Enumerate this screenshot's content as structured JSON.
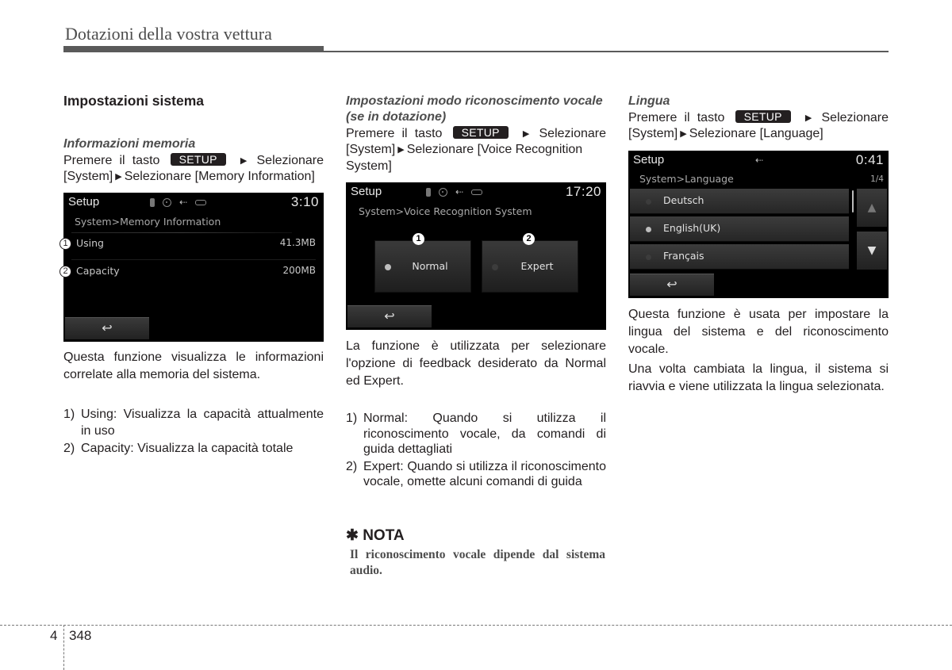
{
  "header": {
    "running_title": "Dotazioni della vostra vettura"
  },
  "setup_key_label": "SETUP",
  "column1": {
    "section_title": "Impostazioni sistema",
    "subtitle": "Informazioni memoria",
    "instruction": {
      "prefix": "Premere il tasto",
      "step1": "Selezionare",
      "line2_a": "[System]",
      "line2_b": "Selezionare [Memory Information]"
    },
    "screen": {
      "title": "Setup",
      "time": "3:10",
      "breadcrumb": "System>Memory Information",
      "rows": [
        {
          "callout": "1",
          "label": "Using",
          "value": "41.3MB"
        },
        {
          "callout": "2",
          "label": "Capacity",
          "value": "200MB"
        }
      ],
      "back_icon": "↩"
    },
    "description": "Questa funzione visualizza le informazioni correlate alla memoria del sistema.",
    "list": [
      {
        "num": "1)",
        "text": "Using: Visualizza la capacità attualmente in uso"
      },
      {
        "num": "2)",
        "text": "Capacity: Visualizza la capacità totale"
      }
    ]
  },
  "column2": {
    "subtitle": "Impostazioni modo riconoscimento vocale (se in dotazione)",
    "instruction": {
      "prefix": "Premere il tasto",
      "step1": "Selezionare",
      "line2_a": "[System]",
      "line2_b": "Selezionare [Voice Recognition System]"
    },
    "screen": {
      "title": "Setup",
      "time": "17:20",
      "breadcrumb": "System>Voice Recognition System",
      "options": [
        {
          "callout": "1",
          "label": "Normal",
          "selected": true
        },
        {
          "callout": "2",
          "label": "Expert",
          "selected": false
        }
      ],
      "back_icon": "↩"
    },
    "description": "La funzione è utilizzata per selezionare l'opzione di feedback desiderato da Normal ed Expert.",
    "list": [
      {
        "num": "1)",
        "text": "Normal: Quando si utilizza il riconoscimento vocale, da comandi di guida dettagliati"
      },
      {
        "num": "2)",
        "text": "Expert: Quando si utilizza il riconoscimento vocale, omette alcuni comandi di guida"
      }
    ],
    "note": {
      "icon": "✱",
      "title": "NOTA",
      "text": "Il riconoscimento vocale dipende dal sistema audio."
    }
  },
  "column3": {
    "subtitle": "Lingua",
    "instruction": {
      "prefix": "Premere il tasto",
      "step1": "Selezionare",
      "line2_a": "[System]",
      "line2_b": "Selezionare [Language]"
    },
    "screen": {
      "title": "Setup",
      "time": "0:41",
      "breadcrumb": "System>Language",
      "page_indicator": "1/4",
      "languages": [
        {
          "label": "Deutsch",
          "selected": false
        },
        {
          "label": "English(UK)",
          "selected": true
        },
        {
          "label": "Français",
          "selected": false
        }
      ],
      "scroll_up_icon": "▲",
      "scroll_down_icon": "▼",
      "back_icon": "↩"
    },
    "description1": "Questa funzione è usata per impostare la lingua del sistema e del riconoscimento vocale.",
    "description2": "Una volta cambiata la lingua, il sistema si riavvia e viene utilizzata la lingua selezionata."
  },
  "footer": {
    "chapter": "4",
    "page": "348"
  },
  "colors": {
    "led_on": "#bdbdbd",
    "led_off": "#3c3c3c",
    "text": "#231f20",
    "heading_gray": "#4d4d4d"
  }
}
